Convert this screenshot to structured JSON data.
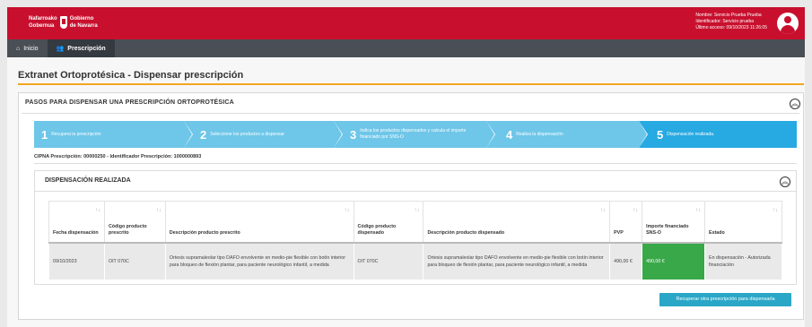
{
  "header": {
    "logo_line1": "Nafarroako",
    "logo_line1b": "Gobierno",
    "logo_line2": "Gobernua",
    "logo_line2b": "de Navarra",
    "user_name": "Nombre: Servicio Prueba Prueba",
    "user_id": "Identificador: Servicio prueba",
    "last_access": "Último acceso: 09/10/2023 11:26:05",
    "brand_color": "#c8102e"
  },
  "nav": {
    "home": "Inicio",
    "prescription": "Prescripción"
  },
  "page": {
    "title": "Extranet Ortoprotésica - Dispensar prescripción"
  },
  "steps_panel": {
    "header": "PASOS PARA DISPENSAR UNA PRESCRIPCIÓN ORTOPROTÉSICA",
    "steps": [
      {
        "num": "1",
        "label": "Recupera la prescripción"
      },
      {
        "num": "2",
        "label": "Seleccione los productos a dispensar"
      },
      {
        "num": "3",
        "label": "Indica los productos dispensados y calcula el importe financiado por SNS-O"
      },
      {
        "num": "4",
        "label": "Realiza la dispensación"
      },
      {
        "num": "5",
        "label": "Dispensación realizada."
      }
    ],
    "cipna": "CIPNA Prescripción: 00000250 - Identificador Prescripción: 1000000893"
  },
  "dispensation": {
    "header": "DISPENSACIÓN REALIZADA",
    "columns": [
      "Fecha dispensación",
      "Código producto prescrito",
      "Descripción producto prescrito",
      "Código producto dispensado",
      "Descripción producto dispensado",
      "PVP",
      "Importe financiado SNS-O",
      "Estado"
    ],
    "rows": [
      {
        "date": "09/10/2023",
        "code_prescribed": "OIT 070C",
        "desc_prescribed": "Ortesis supramaleolar tipo DAFO envolvente en medio-pie flexible con botín interior para bloqueo de flexión plantar, para paciente neurológico infantil, a medida",
        "code_dispensed": "OIT 070C",
        "desc_dispensed": "Ortesis supramaleolar tipo DAFO envolvente en medio-pie flexible con botín interior para bloqueo de flexión plantar, para paciente neurológico infantil, a medida",
        "pvp": "490,00 €",
        "financed": "490,00 €",
        "status": "En dispensación - Autorizada financiación"
      }
    ]
  },
  "actions": {
    "recover": "Recuperar otra prescripción para dispensarla"
  },
  "icons": {
    "home": "home-icon",
    "users": "users-icon",
    "collapse": "chevron-double-up-icon",
    "sort": "sort-icon"
  }
}
